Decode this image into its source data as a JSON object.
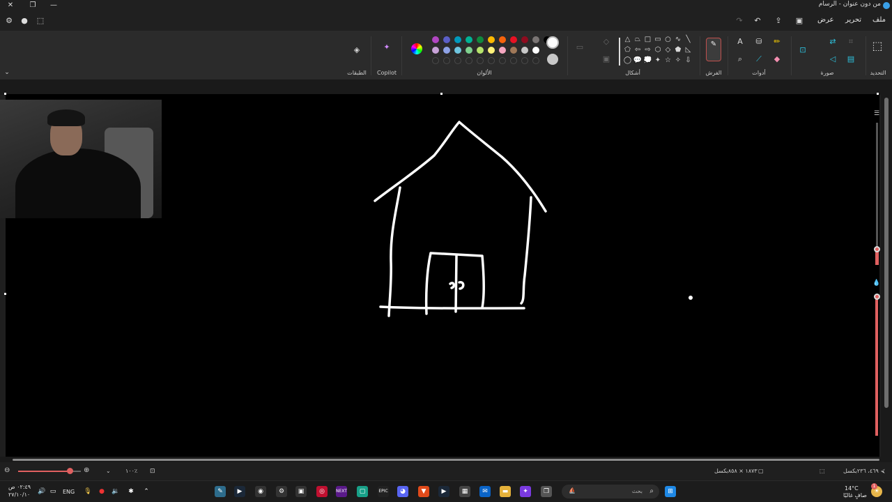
{
  "window": {
    "title": "من دون عنوان - الرسام",
    "close_icon": "close-icon",
    "restore_icon": "restore-icon",
    "minimize_icon": "minimize-icon"
  },
  "menu": {
    "file": "ملف",
    "edit": "تحرير",
    "view": "عرض"
  },
  "ribbon": {
    "groups": {
      "selection": "التحديد",
      "image": "صورة",
      "tools": "أدوات",
      "brushes": "الفرش",
      "shapes": "أشكال",
      "colors": "الألوان",
      "copilot": "Copilot",
      "layers": "الطبقات"
    },
    "palette_row1": [
      "#b146c2",
      "#5b5fc7",
      "#0099bc",
      "#00b294",
      "#10893e",
      "#ffb900",
      "#f7630c",
      "#e81123",
      "#8e0c1f",
      "#7a7574",
      "#000000"
    ],
    "palette_row2": [
      "#c8a2d8",
      "#8ea2e6",
      "#6fc6e0",
      "#7fd18f",
      "#b6e36c",
      "#fff17a",
      "#f4a6c0",
      "#a07858",
      "#c8c8c8",
      "#ffffff"
    ],
    "primary_color": "#ffffff",
    "secondary_color": "#c8c8c8"
  },
  "status": {
    "cursor_pos": "٤٦٩، ٢٣٦بكسل",
    "canvas_size": "١٨٧٣ × ٨٥٨بكسل",
    "zoom": "١٠٠٪"
  },
  "taskbar": {
    "search_placeholder": "بحث",
    "weather_temp": "14°C",
    "weather_desc": "صافٍ غالبًا",
    "lang": "ENG",
    "time": "٠٢:٤٩ ص",
    "date": "٢٧/١٠/١٠",
    "notification_count": "1"
  },
  "canvas": {
    "background": "#000000",
    "stroke": "#ffffff"
  }
}
